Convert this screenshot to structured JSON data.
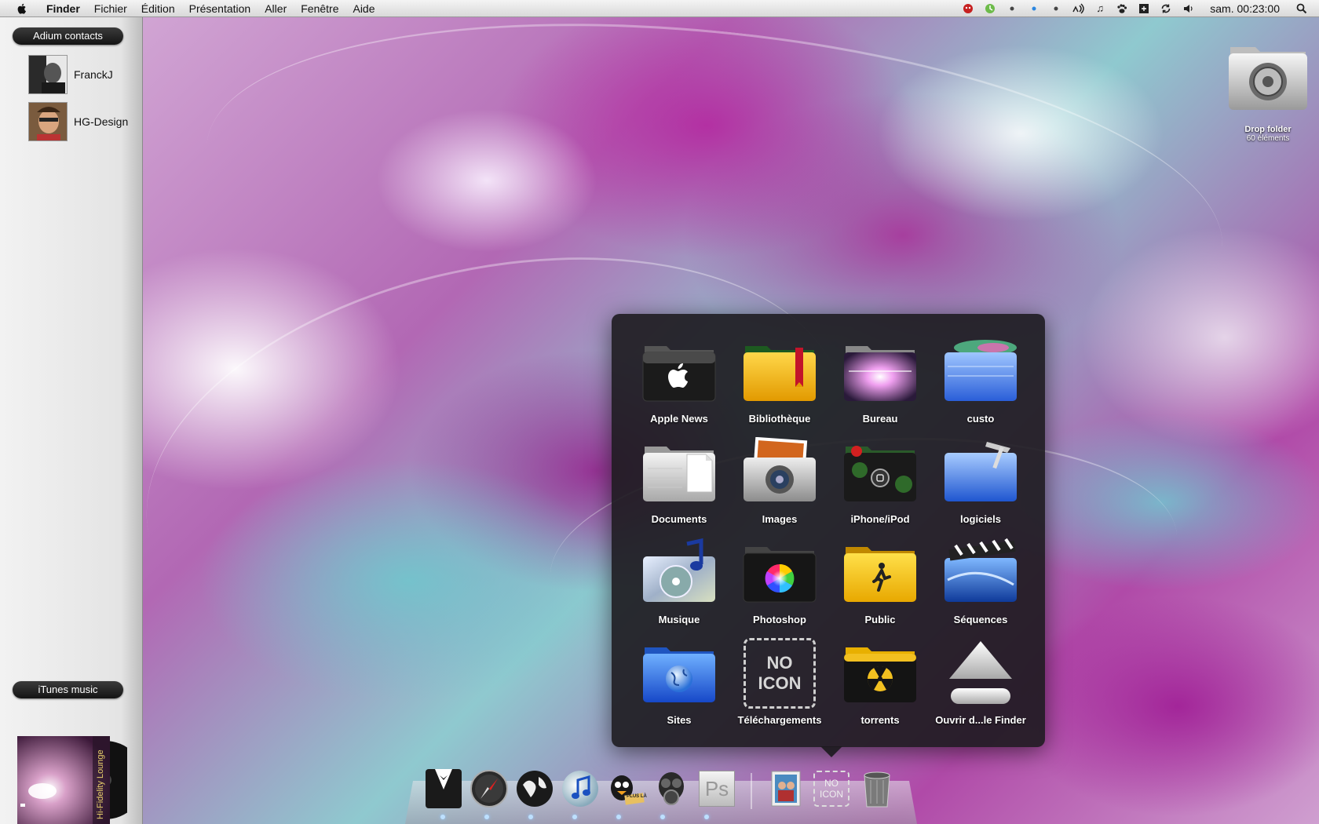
{
  "menubar": {
    "app_name": "Finder",
    "menus": [
      "Fichier",
      "Édition",
      "Présentation",
      "Aller",
      "Fenêtre",
      "Aide"
    ],
    "clock": "sam. 00:23:00"
  },
  "sidebar": {
    "contacts_header": "Adium contacts",
    "contacts": [
      {
        "name": "FranckJ"
      },
      {
        "name": "HG-Design"
      }
    ],
    "music_header": "iTunes music",
    "album_title": "Hi-Fidelity Lounge"
  },
  "desktop": {
    "drop_folder_label": "Drop folder",
    "drop_folder_count": "60 éléments"
  },
  "stack": {
    "items": [
      {
        "label": "Apple News",
        "icon": "apple-folder-icon"
      },
      {
        "label": "Bibliothèque",
        "icon": "library-folder-icon"
      },
      {
        "label": "Bureau",
        "icon": "desktop-folder-icon"
      },
      {
        "label": "custo",
        "icon": "custo-folder-icon"
      },
      {
        "label": "Documents",
        "icon": "documents-folder-icon"
      },
      {
        "label": "Images",
        "icon": "camera-folder-icon"
      },
      {
        "label": "iPhone/iPod",
        "icon": "iphone-folder-icon"
      },
      {
        "label": "logiciels",
        "icon": "applications-folder-icon"
      },
      {
        "label": "Musique",
        "icon": "music-folder-icon"
      },
      {
        "label": "Photoshop",
        "icon": "color-wheel-folder-icon"
      },
      {
        "label": "Public",
        "icon": "public-folder-icon"
      },
      {
        "label": "Séquences",
        "icon": "movies-folder-icon"
      },
      {
        "label": "Sites",
        "icon": "sites-folder-icon"
      },
      {
        "label": "Téléchargements",
        "icon": "no-icon-placeholder-icon",
        "placeholder_text": "NO ICON"
      },
      {
        "label": "torrents",
        "icon": "radioactive-folder-icon"
      },
      {
        "label": "Ouvrir d...le Finder",
        "icon": "eject-icon"
      }
    ]
  },
  "dock": {
    "no_icon_text": "NO ICON",
    "ps_text": "Ps",
    "plus_label": "PLUS LÀ"
  },
  "colors": {
    "menubar_bg": "#e6e6e6",
    "stack_bg": "#1c1a1e",
    "pill_bg": "#1e1e1e"
  }
}
